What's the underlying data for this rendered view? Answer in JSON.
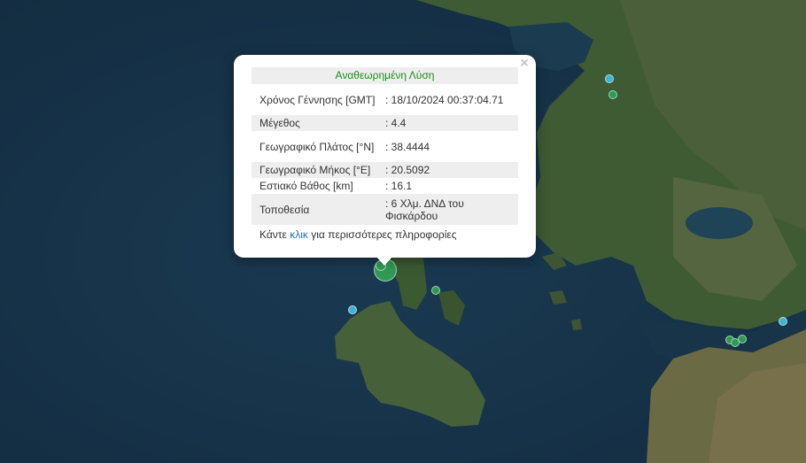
{
  "popup": {
    "title": "Αναθεωρημένη Λύση",
    "close_symbol": "×",
    "rows": [
      {
        "label": "Χρόνος Γέννησης [GMT]",
        "value": ": 18/10/2024 00:37:04.71"
      },
      {
        "label": "Μέγεθος",
        "value": ": 4.4"
      },
      {
        "label": "Γεωγραφικό Πλάτος [°N]",
        "value": ": 38.4444"
      },
      {
        "label": "Γεωγραφικό Μήκος [°E]",
        "value": ": 20.5092"
      },
      {
        "label": "Εστιακό Βάθος [km]",
        "value": ": 16.1"
      },
      {
        "label": "Τοποθεσία",
        "value": ": 6 Χλμ. ΔΝΔ του Φισκάρδου"
      }
    ],
    "more_prefix": "Κάντε ",
    "more_link": "κλικ",
    "more_suffix": " για περισσότερες πληροφορίες"
  },
  "colors": {
    "sea": "#163146",
    "land": "#3d5a33",
    "marker_green": "#2f9a55",
    "marker_cyan": "#3fb4d0",
    "title_green": "#1a8c1a",
    "link_blue": "#1f6fb5"
  },
  "markers": [
    {
      "name": "selected-event-marker",
      "color": "marker_green"
    },
    {
      "name": "event-marker-green",
      "color": "marker_green"
    },
    {
      "name": "event-marker-cyan",
      "color": "marker_cyan"
    },
    {
      "name": "event-marker-cyan",
      "color": "marker_cyan"
    },
    {
      "name": "event-marker-green",
      "color": "marker_green"
    },
    {
      "name": "event-marker-green",
      "color": "marker_green"
    },
    {
      "name": "event-marker-green",
      "color": "marker_green"
    },
    {
      "name": "event-marker-green",
      "color": "marker_green"
    },
    {
      "name": "event-marker-cyan",
      "color": "marker_cyan"
    },
    {
      "name": "event-marker-cyan",
      "color": "marker_cyan"
    }
  ]
}
